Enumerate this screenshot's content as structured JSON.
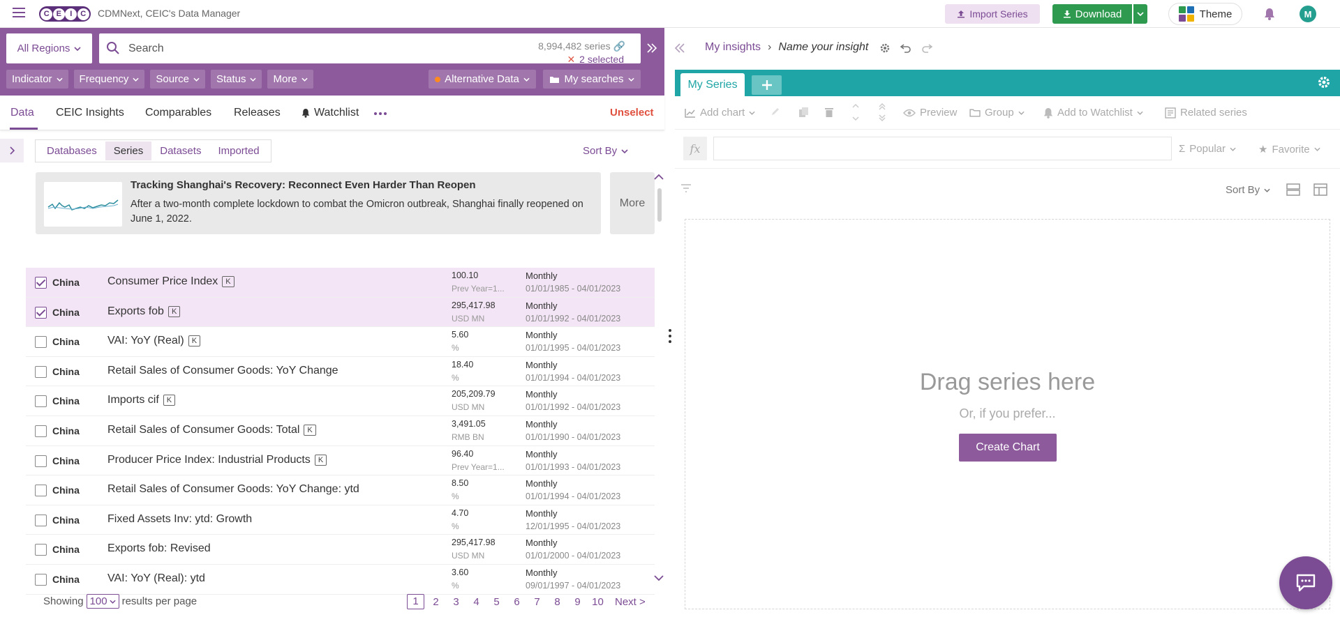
{
  "topbar": {
    "logo_letters": [
      "C",
      "E",
      "I",
      "C"
    ],
    "app_name": "CDMNext, CEIC's Data Manager",
    "import_label": "Import Series",
    "download_label": "Download",
    "theme_label": "Theme",
    "avatar_initial": "M",
    "theme_colors": [
      "#2e9a4f",
      "#1f6fb5",
      "#7b4b94",
      "#f0b400"
    ]
  },
  "search": {
    "region_label": "All Regions",
    "placeholder": "Search",
    "series_count": "8,994,482 series",
    "selected_label": "2 selected"
  },
  "filters": {
    "items": [
      "Indicator",
      "Frequency",
      "Source",
      "Status",
      "More"
    ],
    "alt_data": "Alternative Data",
    "my_searches": "My searches"
  },
  "tabs": {
    "items": [
      "Data",
      "CEIC Insights",
      "Comparables",
      "Releases",
      "Watchlist"
    ],
    "unselect": "Unselect"
  },
  "subtabs": {
    "items": [
      "Databases",
      "Series",
      "Datasets",
      "Imported"
    ],
    "sort_by": "Sort By"
  },
  "insight": {
    "title": "Tracking Shanghai's Recovery: Reconnect Even Harder Than Reopen",
    "text": "After a two-month complete lockdown to combat the Omicron outbreak, Shanghai finally reopened on June 1, 2022.",
    "more": "More"
  },
  "rows": [
    {
      "checked": true,
      "region": "China",
      "name": "Consumer Price Index",
      "k": true,
      "value": "100.10",
      "unit": "Prev Year=1...",
      "freq": "Monthly",
      "range": "01/01/1985 - 04/01/2023"
    },
    {
      "checked": true,
      "region": "China",
      "name": "Exports fob",
      "k": true,
      "value": "295,417.98",
      "unit": "USD MN",
      "freq": "Monthly",
      "range": "01/01/1992 - 04/01/2023"
    },
    {
      "checked": false,
      "region": "China",
      "name": "VAI: YoY (Real)",
      "k": true,
      "value": "5.60",
      "unit": "%",
      "freq": "Monthly",
      "range": "01/01/1995 - 04/01/2023"
    },
    {
      "checked": false,
      "region": "China",
      "name": "Retail Sales of Consumer Goods: YoY Change",
      "k": false,
      "value": "18.40",
      "unit": "%",
      "freq": "Monthly",
      "range": "01/01/1994 - 04/01/2023"
    },
    {
      "checked": false,
      "region": "China",
      "name": "Imports cif",
      "k": true,
      "value": "205,209.79",
      "unit": "USD MN",
      "freq": "Monthly",
      "range": "01/01/1992 - 04/01/2023"
    },
    {
      "checked": false,
      "region": "China",
      "name": "Retail Sales of Consumer Goods: Total",
      "k": true,
      "value": "3,491.05",
      "unit": "RMB BN",
      "freq": "Monthly",
      "range": "01/01/1990 - 04/01/2023"
    },
    {
      "checked": false,
      "region": "China",
      "name": "Producer Price Index: Industrial Products",
      "k": true,
      "value": "96.40",
      "unit": "Prev Year=1...",
      "freq": "Monthly",
      "range": "01/01/1993 - 04/01/2023"
    },
    {
      "checked": false,
      "region": "China",
      "name": "Retail Sales of Consumer Goods: YoY Change: ytd",
      "k": false,
      "value": "8.50",
      "unit": "%",
      "freq": "Monthly",
      "range": "01/01/1994 - 04/01/2023"
    },
    {
      "checked": false,
      "region": "China",
      "name": "Fixed Assets Inv: ytd: Growth",
      "k": false,
      "value": "4.70",
      "unit": "%",
      "freq": "Monthly",
      "range": "12/01/1995 - 04/01/2023"
    },
    {
      "checked": false,
      "region": "China",
      "name": "Exports fob: Revised",
      "k": false,
      "value": "295,417.98",
      "unit": "USD MN",
      "freq": "Monthly",
      "range": "01/01/2000 - 04/01/2023"
    },
    {
      "checked": false,
      "region": "China",
      "name": "VAI: YoY (Real): ytd",
      "k": false,
      "value": "3.60",
      "unit": "%",
      "freq": "Monthly",
      "range": "09/01/1997 - 04/01/2023"
    }
  ],
  "k_badge": "K",
  "footer": {
    "showing": "Showing",
    "per_page": "100",
    "per_page_suffix": "results per page",
    "pages": [
      "1",
      "2",
      "3",
      "4",
      "5",
      "6",
      "7",
      "8",
      "9",
      "10"
    ],
    "current_page": "1",
    "next": "Next >"
  },
  "insight_panel": {
    "breadcrumb_home": "My insights",
    "breadcrumb_sep": "›",
    "insight_name": "Name your insight",
    "series_tab": "My Series",
    "toolbar": {
      "add_chart": "Add chart",
      "preview": "Preview",
      "group": "Group",
      "add_to_watchlist": "Add to Watchlist",
      "related_series": "Related series"
    },
    "fx_label": "fx",
    "popular": "Popular",
    "favorite": "Favorite",
    "sort_by": "Sort By",
    "drop_title": "Drag series here",
    "drop_sub": "Or, if you prefer...",
    "create_chart": "Create Chart"
  },
  "colors": {
    "brand_purple": "#7b4b94",
    "band_purple": "#8d5a9c",
    "teal": "#1fa5a5",
    "green": "#2e9a4f",
    "selected_row": "#f3e5f5"
  }
}
